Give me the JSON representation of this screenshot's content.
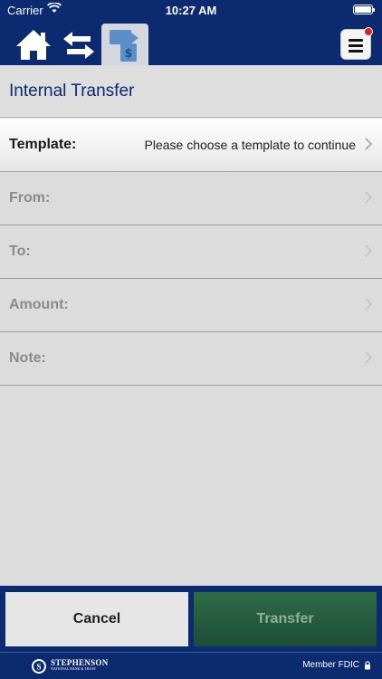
{
  "status_bar": {
    "carrier": "Carrier",
    "time": "10:27 AM"
  },
  "nav": {
    "icons": [
      "home-icon",
      "transfer-arrows-icon",
      "internal-transfer-icon",
      "hamburger-menu-icon"
    ],
    "colors": {
      "nav_bg": "#0b2a6f",
      "active_tab_bg": "#d4d8de",
      "badge": "#e0201a"
    }
  },
  "page": {
    "title": "Internal Transfer"
  },
  "form": {
    "template": {
      "label": "Template:",
      "value": "Please choose a template to continue"
    },
    "from": {
      "label": "From:"
    },
    "to": {
      "label": "To:"
    },
    "amount": {
      "label": "Amount:"
    },
    "note": {
      "label": "Note:"
    }
  },
  "actions": {
    "cancel_label": "Cancel",
    "transfer_label": "Transfer"
  },
  "footer": {
    "bank_name": "STEPHENSON",
    "bank_line": "NATIONAL BANK & TRUST",
    "fdic_text": "Member FDIC"
  }
}
